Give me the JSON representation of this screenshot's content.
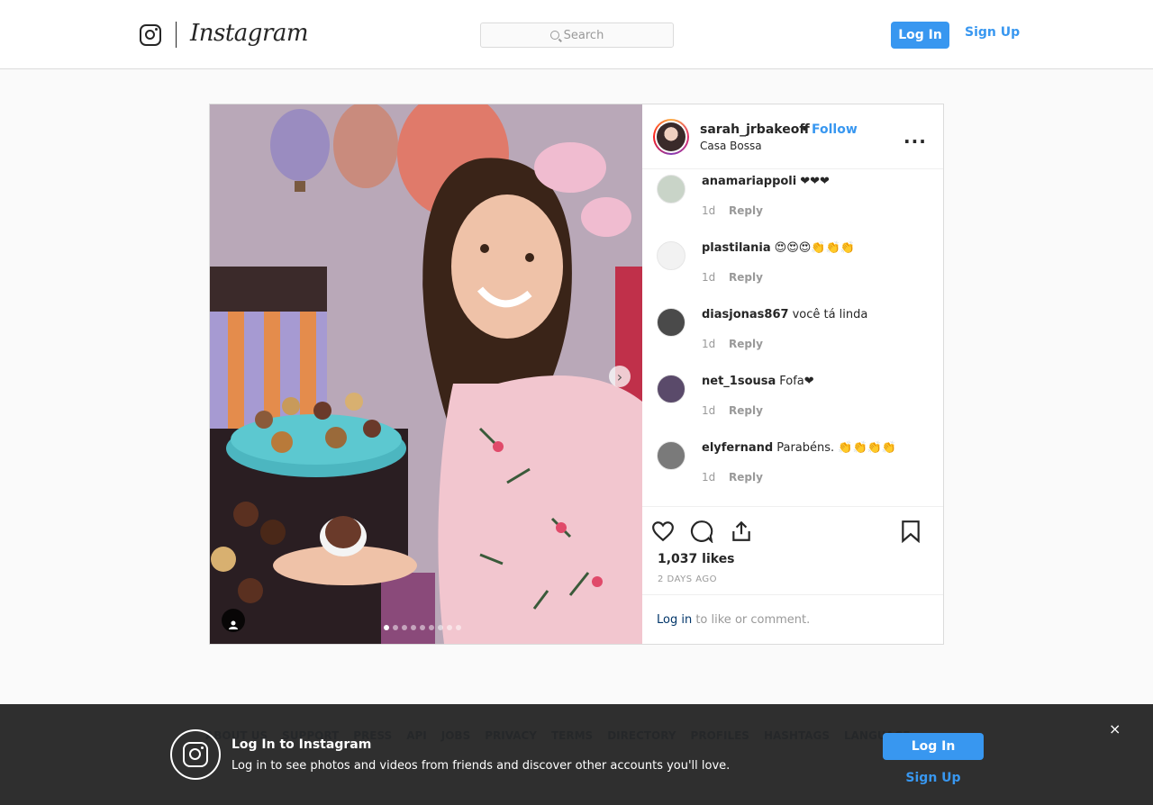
{
  "header": {
    "wordmark": "Instagram",
    "search_placeholder": "Search",
    "login_label": "Log In",
    "signup_label": "Sign Up"
  },
  "post": {
    "username": "sarah_jrbakeoff",
    "bullet": "•",
    "follow_label": "Follow",
    "location": "Casa Bossa",
    "more_label": "...",
    "carousel_dots": 9,
    "carousel_active": 1,
    "comments": [
      {
        "user": "anamariappoli",
        "text": "❤❤❤",
        "age": "1d",
        "reply": "Reply",
        "avatar_color": "#c9d4c8"
      },
      {
        "user": "plastilania",
        "text": "😍😍😍👏👏👏",
        "age": "1d",
        "reply": "Reply",
        "avatar_color": "#f2f2f2"
      },
      {
        "user": "diasjonas867",
        "text": "você tá linda",
        "age": "1d",
        "reply": "Reply",
        "avatar_color": "#4a4a4a"
      },
      {
        "user": "net_1sousa",
        "text": "Fofa❤",
        "age": "1d",
        "reply": "Reply",
        "avatar_color": "#5a4a6a"
      },
      {
        "user": "elyfernand",
        "text": "Parabéns. 👏👏👏👏",
        "age": "1d",
        "reply": "Reply",
        "avatar_color": "#7a7a7a"
      }
    ],
    "likes": "1,037 likes",
    "time_ago": "2 DAYS AGO",
    "login_prompt_link": "Log in",
    "login_prompt_rest": " to like or comment."
  },
  "footer_links": [
    "ABOUT US",
    "SUPPORT",
    "PRESS",
    "API",
    "JOBS",
    "PRIVACY",
    "TERMS",
    "DIRECTORY",
    "PROFILES",
    "HASHTAGS",
    "LANGUAGE"
  ],
  "banner": {
    "title": "Log In to Instagram",
    "subtitle": "Log in to see photos and videos from friends and discover other accounts you'll love.",
    "login_label": "Log In",
    "signup_label": "Sign Up",
    "close_label": "×"
  },
  "colors": {
    "accent": "#3897f0",
    "link_dark": "#003569",
    "banner_bg": "#262626"
  }
}
